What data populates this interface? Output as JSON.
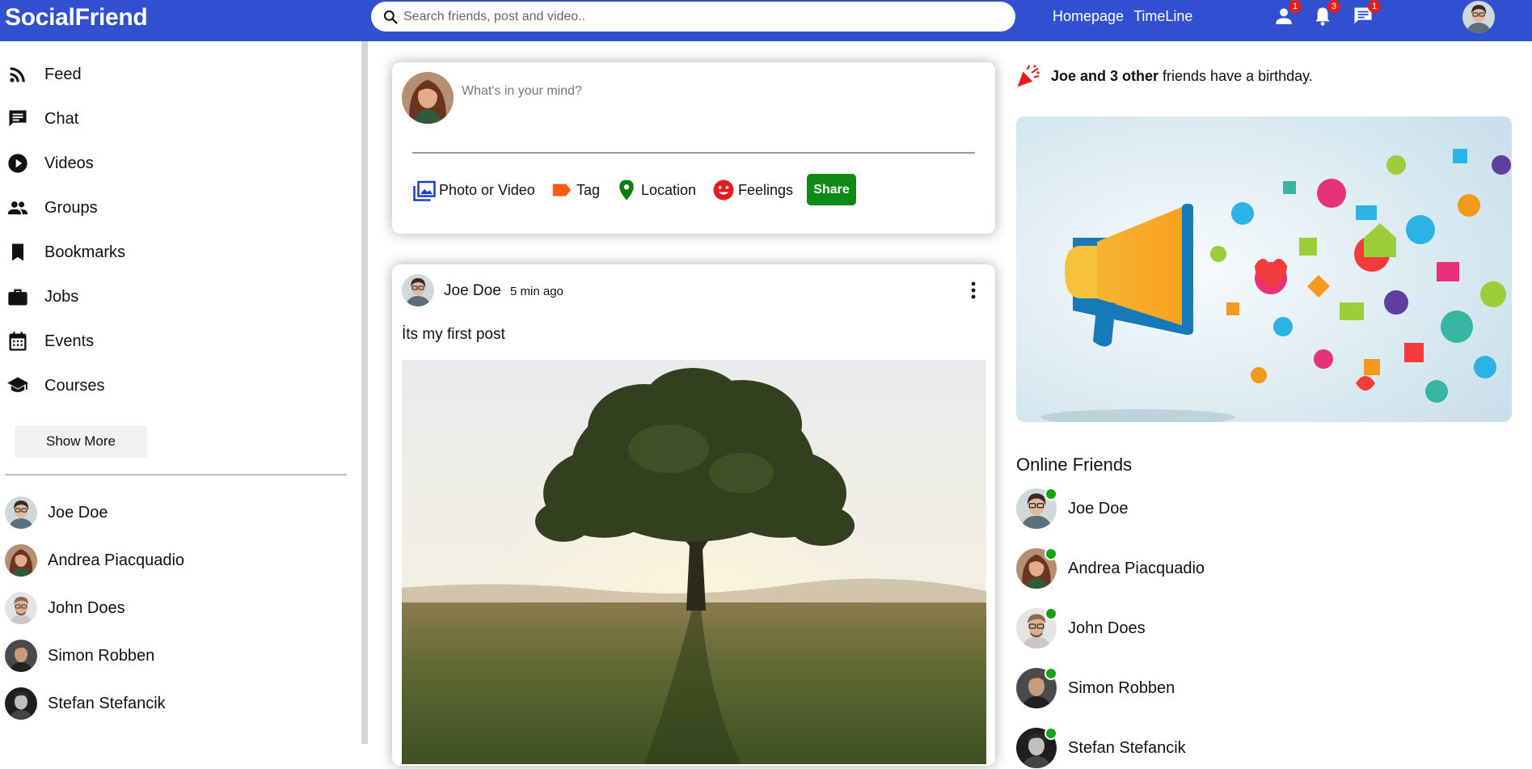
{
  "app": {
    "logo": "SocialFriend"
  },
  "search": {
    "placeholder": "Search friends, post and video.."
  },
  "topnav": {
    "links": [
      "Homepage",
      "TimeLine"
    ],
    "icons": [
      {
        "name": "person-icon",
        "badge": "1"
      },
      {
        "name": "bell-icon",
        "badge": "3"
      },
      {
        "name": "chat-icon",
        "badge": "1"
      }
    ]
  },
  "sidebar": {
    "items": [
      {
        "label": "Feed",
        "icon": "rss-feed-icon"
      },
      {
        "label": "Chat",
        "icon": "chat-bubble-icon"
      },
      {
        "label": "Videos",
        "icon": "play-circle-icon"
      },
      {
        "label": "Groups",
        "icon": "group-icon"
      },
      {
        "label": "Bookmarks",
        "icon": "bookmark-icon"
      },
      {
        "label": "Jobs",
        "icon": "work-icon"
      },
      {
        "label": "Events",
        "icon": "calendar-icon"
      },
      {
        "label": "Courses",
        "icon": "school-icon"
      }
    ],
    "show_more": "Show More",
    "friends": [
      "Joe Doe",
      "Andrea Piacquadio",
      "John Does",
      "Simon Robben",
      "Stefan Stefancik"
    ]
  },
  "share": {
    "placeholder": "What's in your mind?",
    "options": [
      {
        "label": "Photo or Video",
        "icon": "photo-library-icon",
        "color": "#1d3bd6"
      },
      {
        "label": "Tag",
        "icon": "label-icon",
        "color": "#ff5b16"
      },
      {
        "label": "Location",
        "icon": "location-pin-icon",
        "color": "#117a11"
      },
      {
        "label": "Feelings",
        "icon": "emoji-icon",
        "color": "#e51c1c"
      }
    ],
    "button": "Share"
  },
  "post": {
    "user": "Joe Doe",
    "time": "5 min ago",
    "text": "İts my first post"
  },
  "right": {
    "birthday_bold": "Joe and 3 other",
    "birthday_rest": " friends have a birthday.",
    "online_title": "Online Friends",
    "online_friends": [
      "Joe Doe",
      "Andrea Piacquadio",
      "John Does",
      "Simon Robben",
      "Stefan Stefancik"
    ]
  },
  "colors": {
    "topbar": "#3150cf",
    "share_button": "#0f8a17",
    "online": "#16a116",
    "badge": "#e51c1c"
  }
}
